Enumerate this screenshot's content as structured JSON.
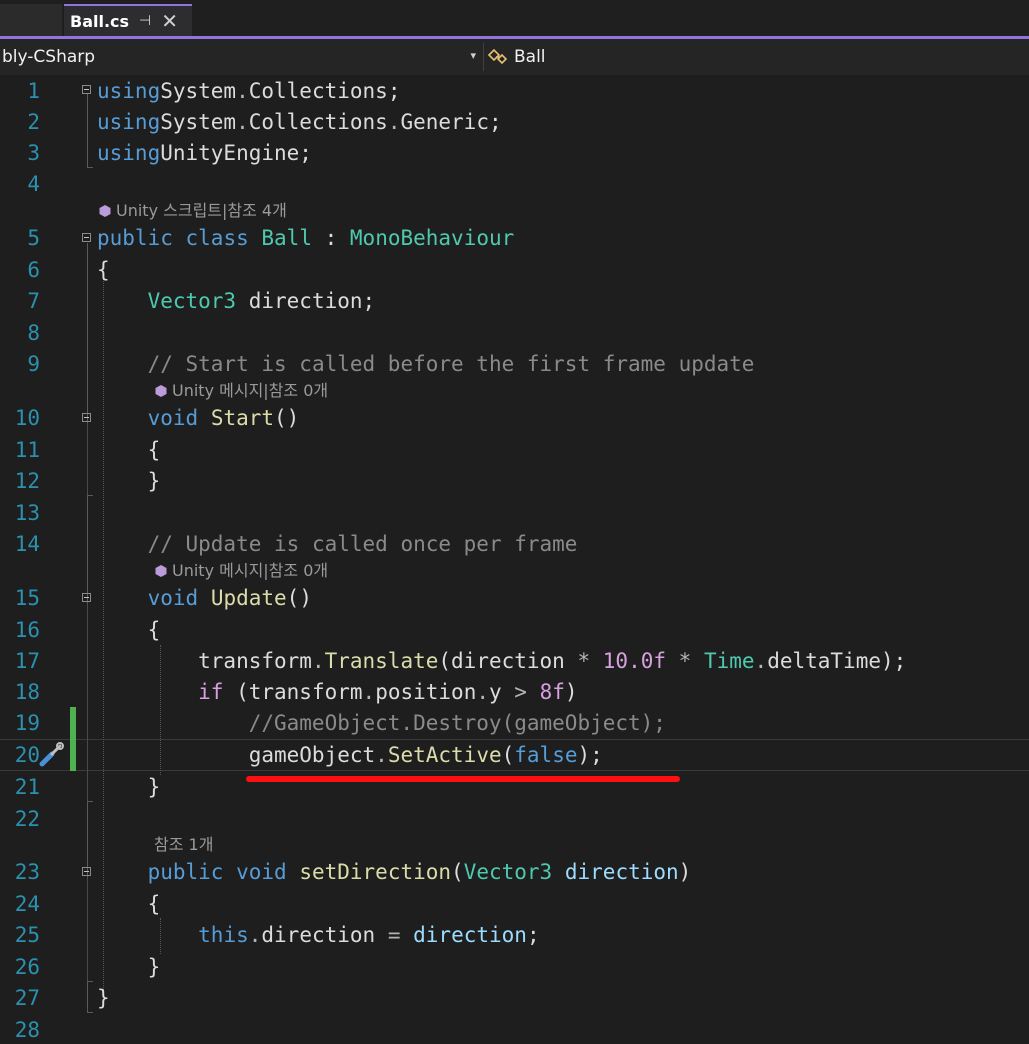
{
  "tabs": {
    "active": {
      "title": "Ball.cs",
      "pin_glyph": "⊣",
      "close_glyph": "✕"
    }
  },
  "navbar": {
    "project": "bly-CSharp",
    "dropdown_glyph": "▾",
    "class_name": "Ball"
  },
  "code_lens": {
    "unity_script": "Unity 스크립트|참조 4개",
    "unity_message_start": "Unity 메시지|참조 0개",
    "unity_message_update": "Unity 메시지|참조 0개",
    "ref_count": "참조 1개"
  },
  "lines": [
    {
      "n": "1",
      "tokens": [
        [
          "kw",
          "using"
        ],
        [
          "",
          "System"
        ],
        [
          "op",
          "."
        ],
        [
          "",
          "Collections"
        ],
        [
          "",
          "; "
        ]
      ]
    },
    {
      "n": "2",
      "tokens": [
        [
          "kw",
          "using"
        ],
        [
          "",
          "System"
        ],
        [
          "op",
          "."
        ],
        [
          "",
          "Collections"
        ],
        [
          "op",
          "."
        ],
        [
          "",
          "Generic"
        ],
        [
          "",
          ";"
        ]
      ]
    },
    {
      "n": "3",
      "tokens": [
        [
          "kw",
          "using"
        ],
        [
          "",
          "UnityEngine;"
        ]
      ]
    },
    {
      "n": "4",
      "tokens": []
    },
    {
      "n": "5",
      "tokens": [
        [
          "kw",
          "public"
        ],
        [
          "",
          " "
        ],
        [
          "kw",
          "class"
        ],
        [
          "",
          " "
        ],
        [
          "ty",
          "Ball"
        ],
        [
          "",
          " : "
        ],
        [
          "ty",
          "MonoBehaviour"
        ]
      ]
    },
    {
      "n": "6",
      "tokens": [
        [
          "",
          "{"
        ]
      ]
    },
    {
      "n": "7",
      "tokens": [
        [
          "",
          "    "
        ],
        [
          "ty",
          "Vector3"
        ],
        [
          "",
          " direction;"
        ]
      ]
    },
    {
      "n": "8",
      "tokens": []
    },
    {
      "n": "9",
      "tokens": [
        [
          "",
          "    "
        ],
        [
          "cmd",
          "// Start is called before the first frame update"
        ]
      ]
    },
    {
      "n": "10",
      "tokens": [
        [
          "",
          "    "
        ],
        [
          "kw",
          "void"
        ],
        [
          "",
          " "
        ],
        [
          "fn",
          "Start"
        ],
        [
          "",
          "()"
        ]
      ]
    },
    {
      "n": "11",
      "tokens": [
        [
          "",
          "    {"
        ]
      ]
    },
    {
      "n": "12",
      "tokens": [
        [
          "",
          "    }"
        ]
      ]
    },
    {
      "n": "13",
      "tokens": []
    },
    {
      "n": "14",
      "tokens": [
        [
          "",
          "    "
        ],
        [
          "cmd",
          "// Update is called once per frame"
        ]
      ]
    },
    {
      "n": "15",
      "tokens": [
        [
          "",
          "    "
        ],
        [
          "kw",
          "void"
        ],
        [
          "",
          " "
        ],
        [
          "fn",
          "Update"
        ],
        [
          "",
          "()"
        ]
      ]
    },
    {
      "n": "16",
      "tokens": [
        [
          "",
          "    {"
        ]
      ]
    },
    {
      "n": "17",
      "tokens": [
        [
          "",
          "        transform"
        ],
        [
          "op",
          "."
        ],
        [
          "fn",
          "Translate"
        ],
        [
          "",
          "(direction "
        ],
        [
          "op",
          "*"
        ],
        [
          "",
          " "
        ],
        [
          "pink",
          "10.0f"
        ],
        [
          "",
          " "
        ],
        [
          "op",
          "*"
        ],
        [
          "",
          " "
        ],
        [
          "ty",
          "Time"
        ],
        [
          "op",
          "."
        ],
        [
          "",
          "deltaTime);"
        ]
      ]
    },
    {
      "n": "18",
      "tokens": [
        [
          "",
          "        "
        ],
        [
          "pink",
          "if"
        ],
        [
          "",
          " (transform"
        ],
        [
          "op",
          "."
        ],
        [
          "",
          "position"
        ],
        [
          "op",
          "."
        ],
        [
          "",
          "y "
        ],
        [
          "op",
          ">"
        ],
        [
          "",
          " "
        ],
        [
          "pink",
          "8f"
        ],
        [
          "",
          ")"
        ]
      ]
    },
    {
      "n": "19",
      "tokens": [
        [
          "",
          "            "
        ],
        [
          "cmd",
          "//GameObject.Destroy(gameObject);"
        ]
      ]
    },
    {
      "n": "20",
      "tokens": [
        [
          "",
          "            gameObject"
        ],
        [
          "op",
          "."
        ],
        [
          "fn",
          "SetActive"
        ],
        [
          "",
          "("
        ],
        [
          "kw",
          "false"
        ],
        [
          "",
          ");"
        ]
      ]
    },
    {
      "n": "21",
      "tokens": [
        [
          "",
          "    }"
        ]
      ]
    },
    {
      "n": "22",
      "tokens": []
    },
    {
      "n": "23",
      "tokens": [
        [
          "",
          "    "
        ],
        [
          "kw",
          "public"
        ],
        [
          "",
          " "
        ],
        [
          "kw",
          "void"
        ],
        [
          "",
          " "
        ],
        [
          "fn",
          "setDirection"
        ],
        [
          "",
          "("
        ],
        [
          "ty",
          "Vector3"
        ],
        [
          "",
          " "
        ],
        [
          "var",
          "direction"
        ],
        [
          "",
          ")"
        ]
      ]
    },
    {
      "n": "24",
      "tokens": [
        [
          "",
          "    {"
        ]
      ]
    },
    {
      "n": "25",
      "tokens": [
        [
          "",
          "        "
        ],
        [
          "kw",
          "this"
        ],
        [
          "op",
          "."
        ],
        [
          "",
          "direction "
        ],
        [
          "op",
          "="
        ],
        [
          "",
          " "
        ],
        [
          "var",
          "direction"
        ],
        [
          "",
          ";"
        ]
      ]
    },
    {
      "n": "26",
      "tokens": [
        [
          "",
          "    }"
        ]
      ]
    },
    {
      "n": "27",
      "tokens": [
        [
          "",
          "}"
        ]
      ]
    },
    {
      "n": "28",
      "tokens": []
    }
  ]
}
